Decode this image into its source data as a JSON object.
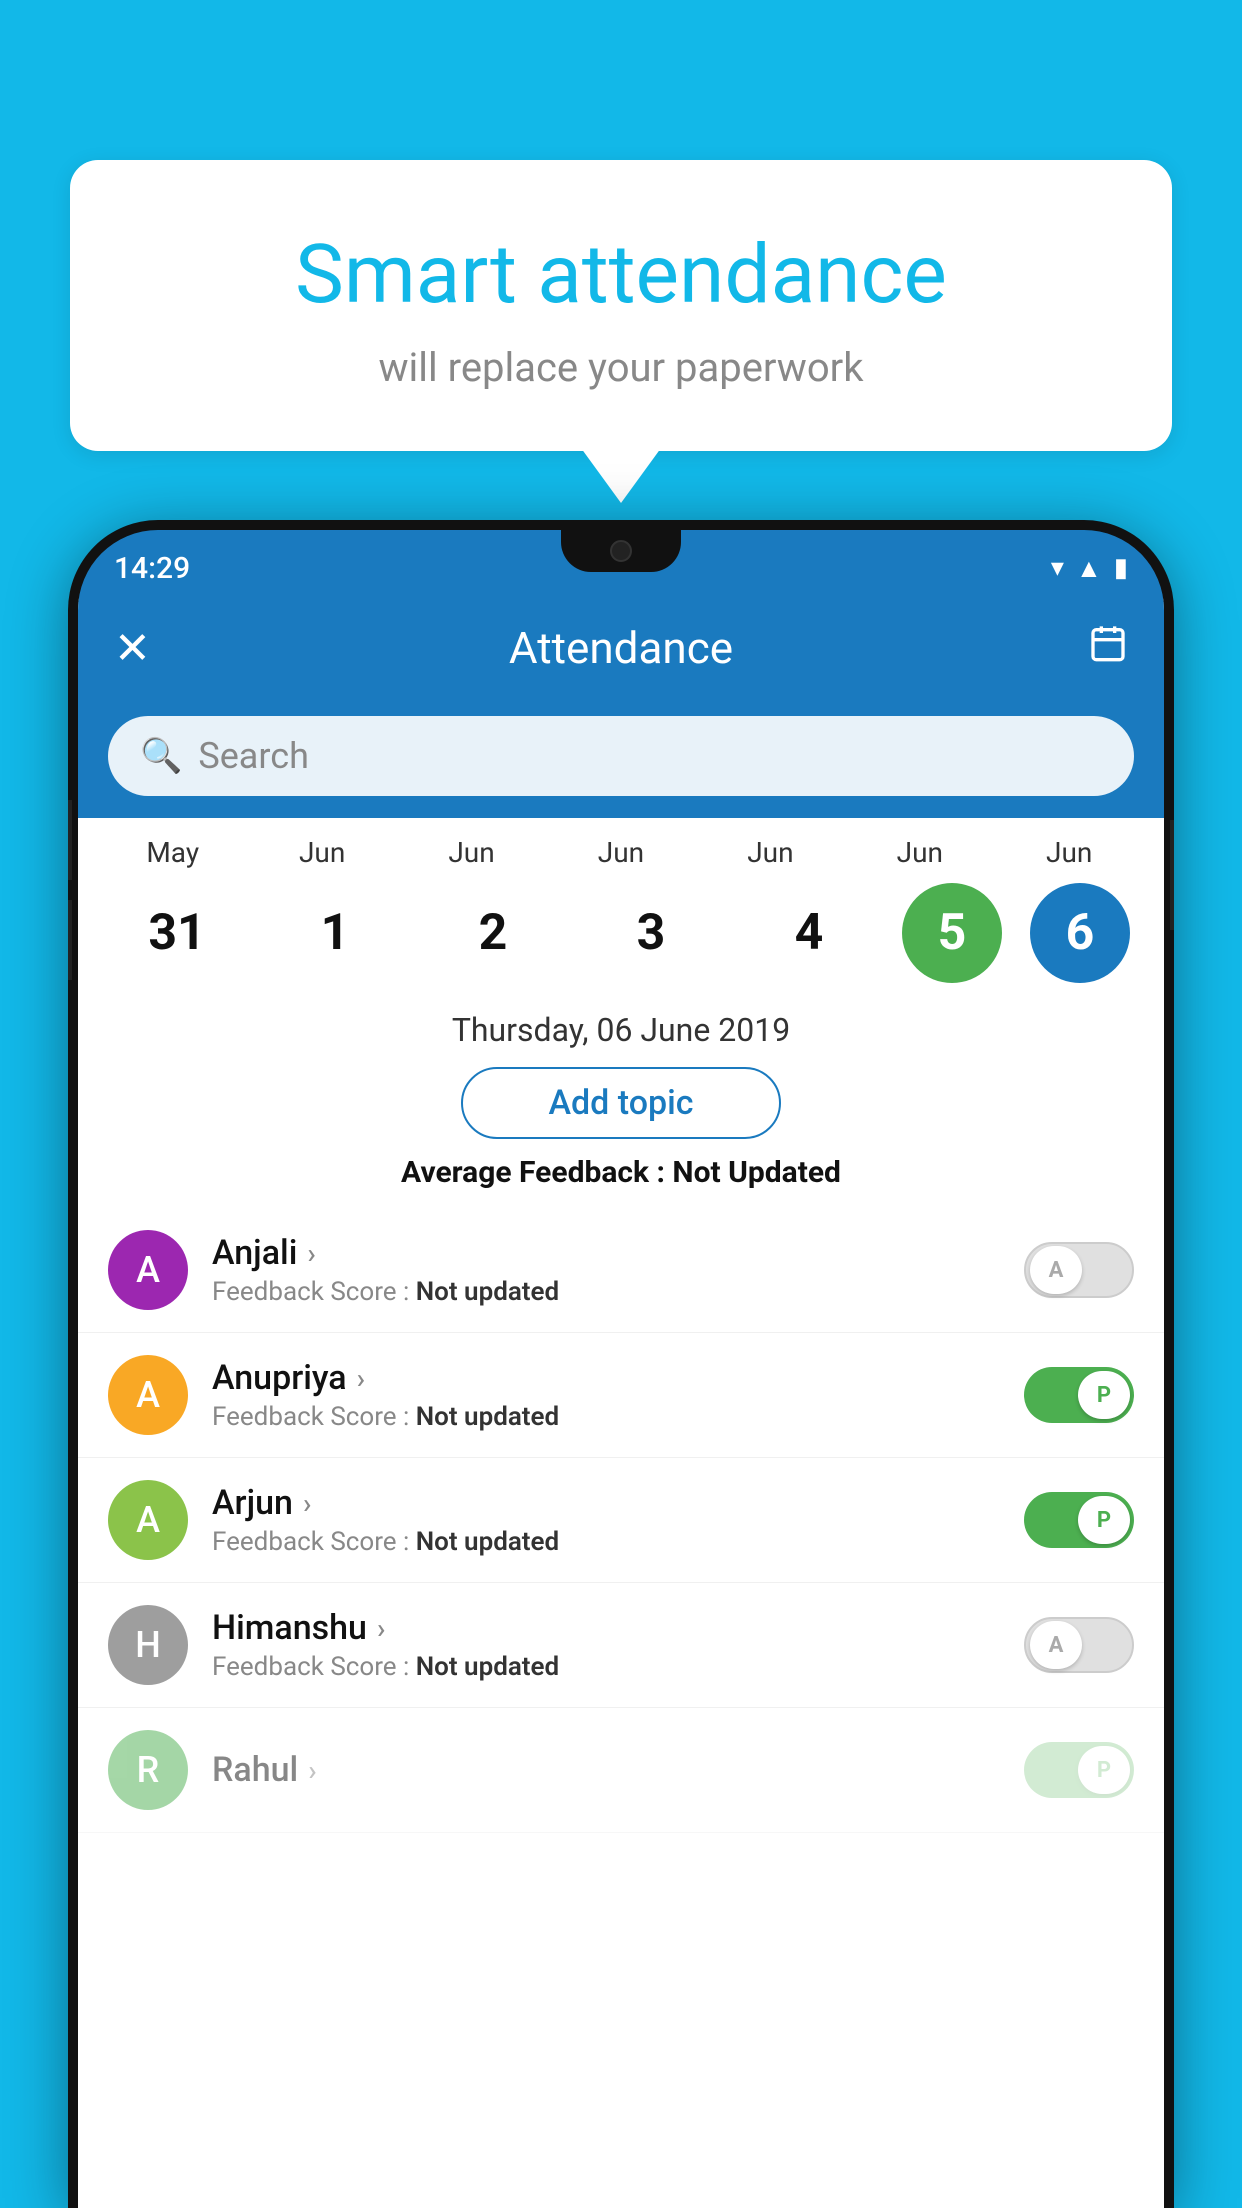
{
  "background_color": "#12b8e8",
  "speech_bubble": {
    "title": "Smart attendance",
    "subtitle": "will replace your paperwork"
  },
  "status_bar": {
    "time": "14:29",
    "wifi": "▲",
    "signal": "▲",
    "battery": "▮"
  },
  "app_bar": {
    "title": "Attendance",
    "close_label": "✕",
    "calendar_label": "📅"
  },
  "search": {
    "placeholder": "Search"
  },
  "calendar": {
    "months": [
      "May",
      "Jun",
      "Jun",
      "Jun",
      "Jun",
      "Jun",
      "Jun"
    ],
    "dates": [
      "31",
      "1",
      "2",
      "3",
      "4",
      "5",
      "6"
    ],
    "today_index": 5,
    "selected_index": 6,
    "selected_date_label": "Thursday, 06 June 2019"
  },
  "add_topic": {
    "label": "Add topic"
  },
  "average_feedback": {
    "label": "Average Feedback : ",
    "value": "Not Updated"
  },
  "students": [
    {
      "name": "Anjali",
      "avatar_letter": "A",
      "avatar_color": "#9c27b0",
      "feedback_label": "Feedback Score : ",
      "feedback_value": "Not updated",
      "toggle_state": "off",
      "toggle_letter": "A"
    },
    {
      "name": "Anupriya",
      "avatar_letter": "A",
      "avatar_color": "#f9a825",
      "feedback_label": "Feedback Score : ",
      "feedback_value": "Not updated",
      "toggle_state": "on",
      "toggle_letter": "P"
    },
    {
      "name": "Arjun",
      "avatar_letter": "A",
      "avatar_color": "#8bc34a",
      "feedback_label": "Feedback Score : ",
      "feedback_value": "Not updated",
      "toggle_state": "on",
      "toggle_letter": "P"
    },
    {
      "name": "Himanshu",
      "avatar_letter": "H",
      "avatar_color": "#9e9e9e",
      "feedback_label": "Feedback Score : ",
      "feedback_value": "Not updated",
      "toggle_state": "off",
      "toggle_letter": "A"
    }
  ]
}
